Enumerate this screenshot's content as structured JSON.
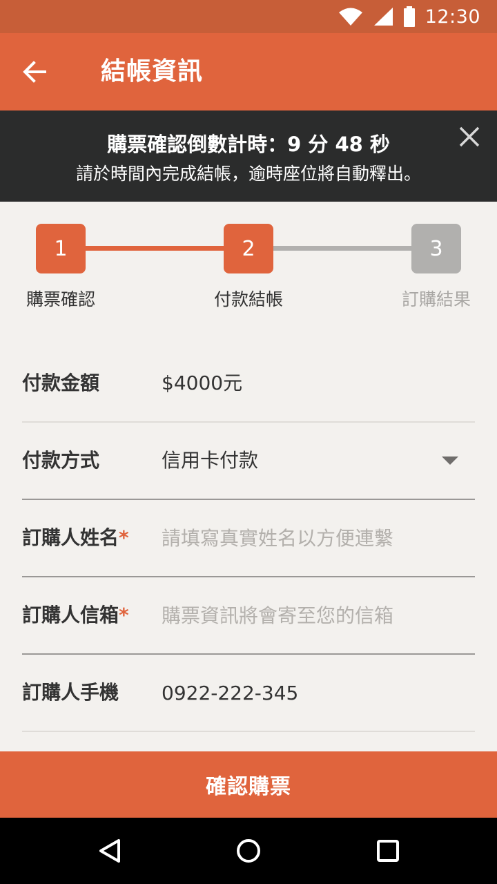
{
  "status_bar": {
    "time": "12:30"
  },
  "app_bar": {
    "title": "結帳資訊"
  },
  "timer_banner": {
    "countdown_text": "購票確認倒數計時：9 分 48 秒",
    "notice_text": "請於時間內完成結帳，逾時座位將自動釋出。"
  },
  "stepper": {
    "steps": [
      {
        "number": "1",
        "label": "購票確認",
        "state": "done"
      },
      {
        "number": "2",
        "label": "付款結帳",
        "state": "current"
      },
      {
        "number": "3",
        "label": "訂購結果",
        "state": "pending"
      }
    ],
    "colors": {
      "active": "#e0643d",
      "inactive": "#b1b0ae"
    }
  },
  "form": {
    "amount": {
      "label": "付款金額",
      "value": "$4000元"
    },
    "payment_method": {
      "label": "付款方式",
      "value": "信用卡付款"
    },
    "name": {
      "label": "訂購人姓名",
      "required_mark": "*",
      "value": "",
      "placeholder": "請填寫真實姓名以方便連繫"
    },
    "email": {
      "label": "訂購人信箱",
      "required_mark": "*",
      "value": "",
      "placeholder": "購票資訊將會寄至您的信箱"
    },
    "phone": {
      "label": "訂購人手機",
      "value": "0922-222-345"
    }
  },
  "confirm_button": {
    "label": "確認購票"
  },
  "theme": {
    "accent": "#e0643d",
    "status_bar": "#c75e38",
    "banner": "#2b2c2c"
  }
}
